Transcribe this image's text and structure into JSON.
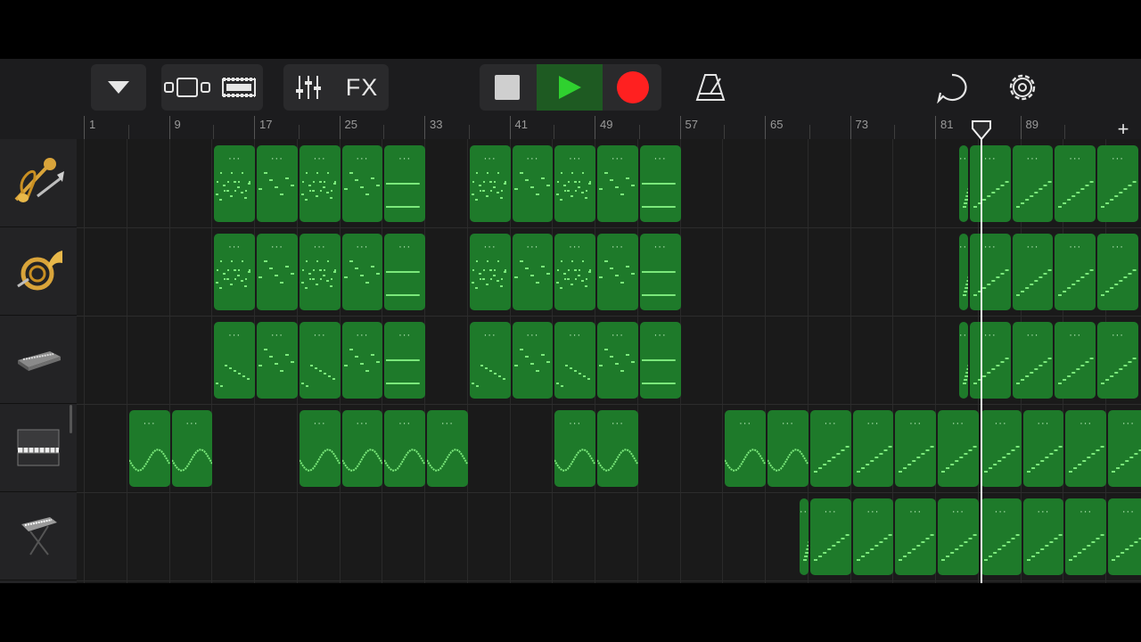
{
  "toolbar": {
    "tracks_view_icon": "triangle-down-icon",
    "browser_icon": "browser-icon",
    "tracks_icon": "tracks-icon",
    "mixer_icon": "mixer-icon",
    "fx_label": "FX",
    "stop_icon": "stop-icon",
    "play_icon": "play-icon",
    "record_icon": "record-icon",
    "metronome_icon": "metronome-icon",
    "loop_icon": "loop-icon",
    "settings_icon": "gear-icon"
  },
  "colors": {
    "region": "#1e7a2a",
    "notes": "#7be87b",
    "play": "#2fd12f",
    "record": "#ff2020",
    "background": "#1c1c1e"
  },
  "ruler": {
    "labels": [
      "1",
      "9",
      "17",
      "25",
      "33",
      "41",
      "49",
      "57",
      "65",
      "73",
      "81",
      "89"
    ],
    "add_label": "+"
  },
  "tracks": [
    {
      "instrument": "brass-icon"
    },
    {
      "instrument": "french-horn-icon"
    },
    {
      "instrument": "keyboard-module-icon"
    },
    {
      "instrument": "upright-piano-icon"
    },
    {
      "instrument": "synth-keyboard-icon"
    }
  ],
  "region_label": "···"
}
